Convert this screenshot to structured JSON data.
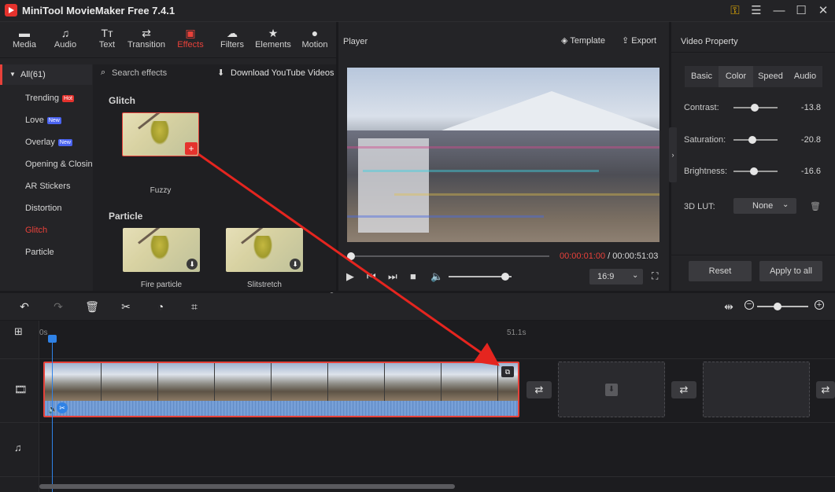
{
  "app": {
    "title": "MiniTool MovieMaker Free 7.4.1"
  },
  "tabs": [
    {
      "label": "Media",
      "icon": "folder-icon"
    },
    {
      "label": "Audio",
      "icon": "music-icon"
    },
    {
      "label": "Text",
      "icon": "text-icon"
    },
    {
      "label": "Transition",
      "icon": "transition-icon"
    },
    {
      "label": "Effects",
      "icon": "effects-icon",
      "active": true
    },
    {
      "label": "Filters",
      "icon": "filters-icon"
    },
    {
      "label": "Elements",
      "icon": "elements-icon"
    },
    {
      "label": "Motion",
      "icon": "motion-icon"
    }
  ],
  "categories": {
    "all_label": "All(61)",
    "items": [
      {
        "label": "Trending",
        "badge": "Hot"
      },
      {
        "label": "Love",
        "badge": "New"
      },
      {
        "label": "Overlay",
        "badge": "New"
      },
      {
        "label": "Opening & Closing"
      },
      {
        "label": "AR Stickers"
      },
      {
        "label": "Distortion"
      },
      {
        "label": "Glitch",
        "active": true
      },
      {
        "label": "Particle"
      }
    ]
  },
  "effects": {
    "search_placeholder": "Search effects",
    "download_label": "Download YouTube Videos",
    "sections": [
      {
        "title": "Glitch",
        "items": [
          {
            "label": "Fuzzy"
          }
        ]
      },
      {
        "title": "Particle",
        "items": [
          {
            "label": "Fire particle"
          },
          {
            "label": "Slitstretch"
          }
        ]
      }
    ]
  },
  "player": {
    "title": "Player",
    "template_label": "Template",
    "export_label": "Export",
    "current_time": "00:00:01:00",
    "separator": " / ",
    "total_time": "00:00:51:03",
    "aspect_ratio": "16:9",
    "volume_level": 0.9,
    "progress": 0.02
  },
  "property": {
    "title": "Video Property",
    "tabs": [
      {
        "label": "Basic"
      },
      {
        "label": "Color",
        "active": true
      },
      {
        "label": "Speed"
      },
      {
        "label": "Audio"
      }
    ],
    "rows": [
      {
        "label": "Contrast:",
        "value": "-13.8",
        "level": 0.48
      },
      {
        "label": "Saturation:",
        "value": "-20.8",
        "level": 0.43
      },
      {
        "label": "Brightness:",
        "value": "-16.6",
        "level": 0.46
      }
    ],
    "lut_label": "3D LUT:",
    "lut_value": "None",
    "reset_label": "Reset",
    "apply_label": "Apply to all"
  },
  "timeline": {
    "ruler_start": "0s",
    "ruler_end": "51.1s",
    "zoom_level": 0.4
  },
  "colors": {
    "accent": "#e8413a",
    "playhead": "#2f82e6",
    "panel": "#242427"
  }
}
